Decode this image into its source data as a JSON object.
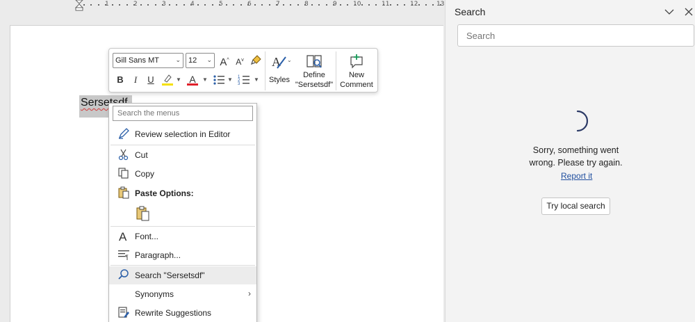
{
  "ruler": {
    "labels": [
      "1",
      "2",
      "3",
      "4",
      "5",
      "6",
      "7",
      "8",
      "9",
      "10",
      "11",
      "12",
      "13"
    ]
  },
  "document": {
    "selected_text": "Sersetsdf"
  },
  "mini_toolbar": {
    "font_name": "Gill Sans MT",
    "font_size": "12",
    "grow_font": "A",
    "shrink_font": "A",
    "bold": "B",
    "italic": "I",
    "underline": "U",
    "font_color_letter": "A",
    "highlight_color": "#f5e000",
    "font_color": "#e0202a",
    "styles_label": "Styles",
    "define_label_line1": "Define",
    "define_label_line2": "\"Sersetsdf\"",
    "new_comment_line1": "New",
    "new_comment_line2": "Comment"
  },
  "context_menu": {
    "search_placeholder": "Search the menus",
    "items": [
      {
        "label": "Review selection in Editor",
        "icon": "editor-pen-icon"
      },
      {
        "label": "Cut",
        "icon": "scissors-icon"
      },
      {
        "label": "Copy",
        "icon": "copy-icon"
      },
      {
        "label": "Paste Options:",
        "icon": "paste-icon"
      },
      {
        "label": "Font...",
        "icon": "font-icon"
      },
      {
        "label": "Paragraph...",
        "icon": "paragraph-icon"
      },
      {
        "label": "Search \"Sersetsdf\"",
        "icon": "search-icon"
      },
      {
        "label": "Synonyms",
        "icon": ""
      },
      {
        "label": "Rewrite Suggestions",
        "icon": "rewrite-icon"
      }
    ]
  },
  "search_pane": {
    "title": "Search",
    "search_placeholder": "Search",
    "error_line1": "Sorry, something went",
    "error_line2": "wrong. Please try again.",
    "report_link": "Report it",
    "local_search_button": "Try local search"
  }
}
